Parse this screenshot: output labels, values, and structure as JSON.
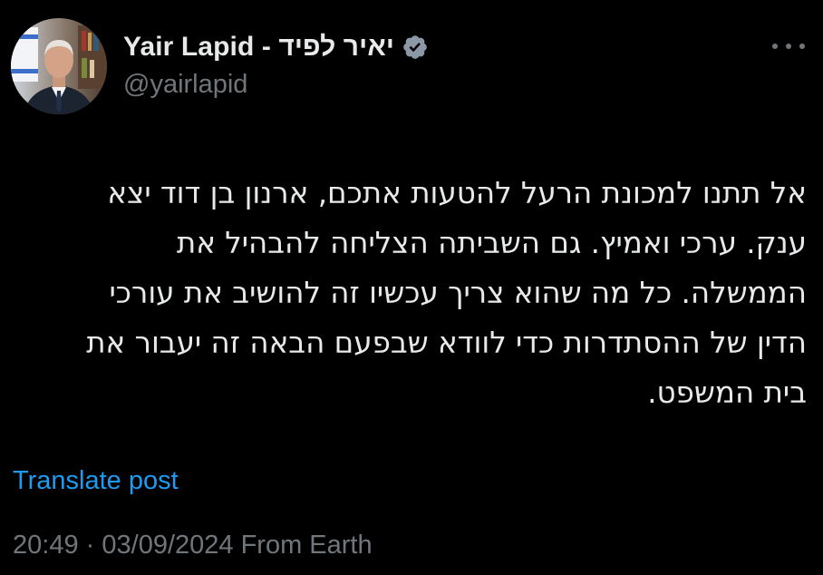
{
  "author": {
    "display_name": "Yair Lapid - יאיר לפיד",
    "handle": "@yairlapid",
    "verified_badge_icon": "verified-badge-icon",
    "badge_color": "#8b98a5"
  },
  "tweet": {
    "lines": [
      "אל תתנו למכונת הרעל להטעות אתכם, ארנון בן דוד יצא",
      "ענק. ערכי ואמיץ. גם השביתה הצליחה להבהיל את",
      "הממשלה. כל מה שהוא צריך עכשיו זה להושיב את עורכי",
      "הדין של ההסתדרות כדי לוודא שבפעם הבאה זה יעבור את",
      "בית המשפט."
    ]
  },
  "actions": {
    "translate_label": "Translate post",
    "more_icon": "more-horizontal-icon"
  },
  "meta": {
    "time": "20:49",
    "separator": "·",
    "date": "03/09/2024",
    "source": "From Earth"
  },
  "colors": {
    "background": "#000000",
    "primary_text": "#e7e9ea",
    "secondary_text": "#71767b",
    "link": "#1d9bf0"
  }
}
